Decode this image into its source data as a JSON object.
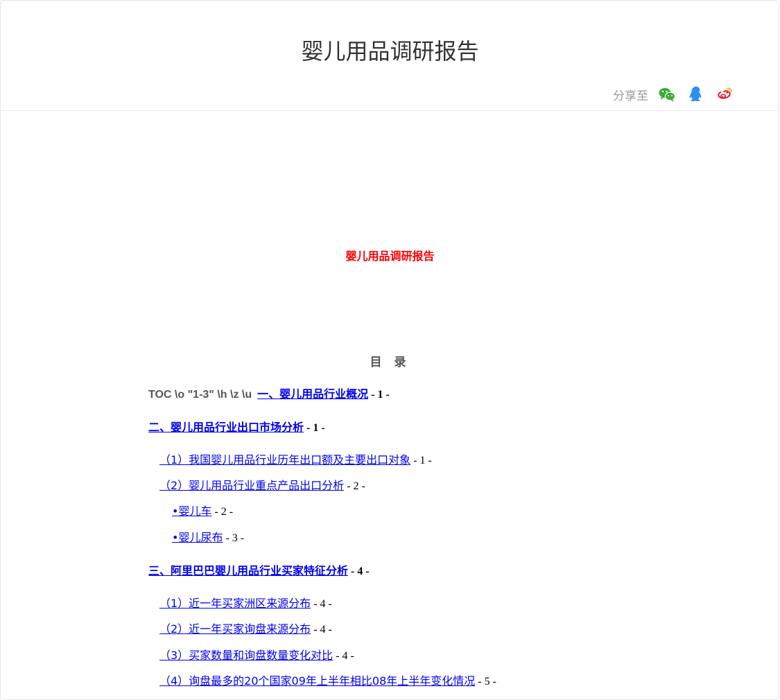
{
  "header": {
    "title": "婴儿用品调研报告",
    "share_label": "分享至",
    "share_icons": [
      "wechat-icon",
      "qq-icon",
      "weibo-icon"
    ],
    "colors": {
      "wechat": "#3bab35",
      "qq": "#2a8ff0",
      "weibo": "#e6162d"
    }
  },
  "document": {
    "title": "婴儿用品调研报告",
    "toc_heading": "目 录",
    "toc_field": "TOC \\o \"1-3\" \\h \\z \\u",
    "entries": [
      {
        "text": "一、婴儿用品行业概况",
        "page": " - 1 -"
      },
      {
        "text": "二、婴儿用品行业出口市场分析",
        "page": " - 1 -"
      },
      {
        "text": "（1）我国婴儿用品行业历年出口额及主要出口对象",
        "page": " - 1 -"
      },
      {
        "text": "（2）婴儿用品行业重点产品出口分析",
        "page": " - 2 -"
      },
      {
        "text": "•婴儿车",
        "page": " - 2 -"
      },
      {
        "text": "•婴儿尿布",
        "page": " - 3 -"
      },
      {
        "text": "三、阿里巴巴婴儿用品行业买家特征分析",
        "page": " - 4 -"
      },
      {
        "text": "（1）近一年买家洲区来源分布",
        "page": " - 4 -"
      },
      {
        "text": "（2）近一年买家询盘来源分布",
        "page": " - 4 -"
      },
      {
        "text": "（3）买家数量和询盘数量变化对比",
        "page": " - 4 -"
      },
      {
        "text": "（4）询盘最多的20个国家09年上半年相比08年上半年变化情况",
        "page": " - 5 -"
      }
    ]
  }
}
